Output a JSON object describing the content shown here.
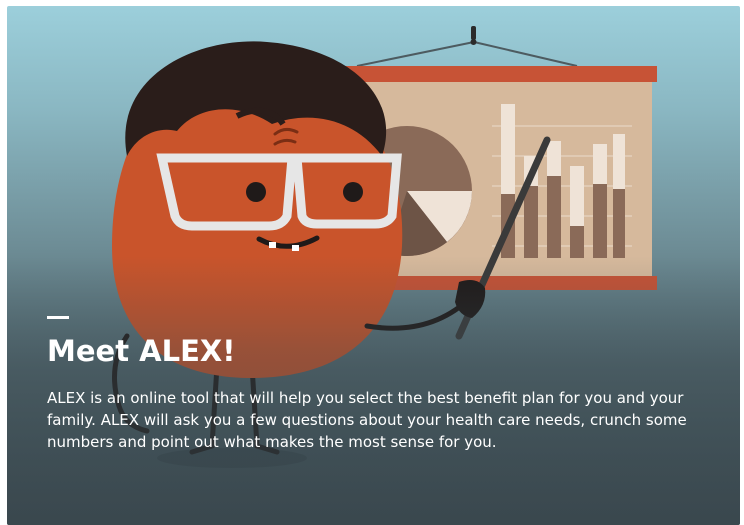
{
  "card": {
    "title": "Meet ALEX!",
    "description": "ALEX is an online tool that will help you select the best benefit plan for you and your family. ALEX will ask you a few questions about your health care needs, crunch some numbers and point out what makes the most sense for you."
  },
  "colors": {
    "character_body": "#c9542b",
    "hair": "#2a1d1a",
    "glasses": "#e6e6e6",
    "board_frame": "#c75336",
    "board_panel": "#d6b99c",
    "text": "#ffffff"
  },
  "icons": {
    "illustration": "alex-presenter-illustration"
  }
}
